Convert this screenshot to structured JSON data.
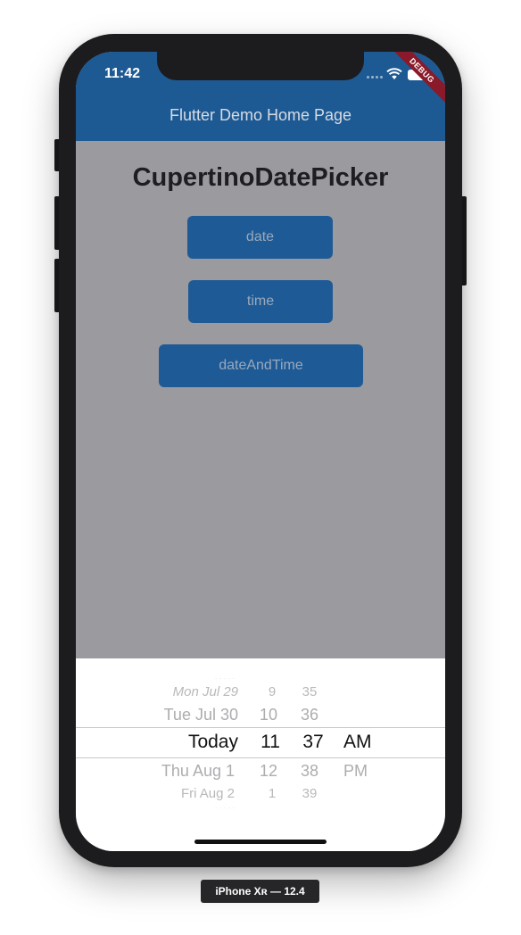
{
  "status_bar": {
    "time": "11:42",
    "debug_banner": "DEBUG"
  },
  "app_bar": {
    "title": "Flutter Demo Home Page"
  },
  "content": {
    "heading": "CupertinoDatePicker",
    "buttons": [
      "date",
      "time",
      "dateAndTime"
    ]
  },
  "date_picker": {
    "selected": {
      "date": "Today",
      "hour": "11",
      "minute": "37",
      "period": "AM"
    },
    "rows_above": [
      {
        "date": "Mon Jul 29",
        "hour": "9",
        "minute": "35"
      },
      {
        "date": "Tue Jul 30",
        "hour": "10",
        "minute": "36"
      }
    ],
    "rows_below": [
      {
        "date": "Thu Aug 1",
        "hour": "12",
        "minute": "38",
        "period": "PM"
      },
      {
        "date": "Fri Aug 2",
        "hour": "1",
        "minute": "39"
      }
    ]
  },
  "device_label": "iPhone Xʀ — 12.4",
  "colors": {
    "app_bar": "#1d5a94",
    "button": "#1e5b96",
    "background_scrim": "#9b9a9f",
    "picker_background": "#ffffff",
    "debug_ribbon": "#8a1a2a"
  }
}
